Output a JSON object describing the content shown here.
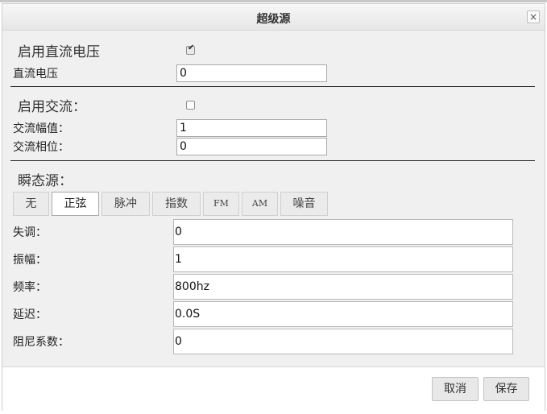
{
  "dialog": {
    "title": "超级源",
    "close_glyph": "×"
  },
  "dc": {
    "enable_label": "启用直流电压",
    "enable_checked": true,
    "voltage_label": "直流电压",
    "voltage_value": "0"
  },
  "ac": {
    "enable_label": "启用交流：",
    "enable_checked": false,
    "amplitude_label": "交流幅值：",
    "amplitude_value": "1",
    "phase_label": "交流相位：",
    "phase_value": "0"
  },
  "transient": {
    "section_label": "瞬态源：",
    "tabs": [
      "无",
      "正弦",
      "脉冲",
      "指数",
      "FM",
      "AM",
      "噪音"
    ],
    "active_tab": "正弦",
    "fields": [
      {
        "label": "失调：",
        "value": "0"
      },
      {
        "label": "振幅：",
        "value": "1"
      },
      {
        "label": "频率：",
        "value": "800hz"
      },
      {
        "label": "延迟：",
        "value": "0.0S"
      },
      {
        "label": "阻尼系数：",
        "value": "0"
      }
    ]
  },
  "footer": {
    "cancel_label": "取消",
    "save_label": "保存"
  }
}
